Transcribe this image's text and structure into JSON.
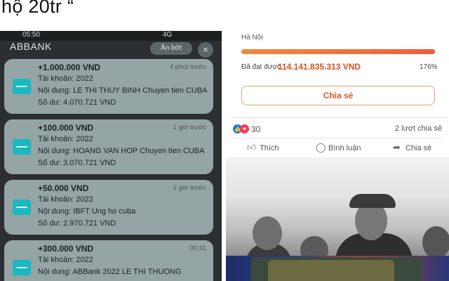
{
  "caption": {
    "text": "hộ 20tr “"
  },
  "phone": {
    "status_time": "05:50",
    "status_signal": "4G",
    "app_name": "ABBANK",
    "hide_label": "Ẩn bớt",
    "close_label": "×",
    "notifications": [
      {
        "amount": "+1.000.000 VND",
        "time": "4 phút trước",
        "account": "Tài khoản: 2022",
        "content": "Nội dung: LE THI THUY BINH Chuyen tien CUBA",
        "balance": "Số dư: 4.070.721 VND"
      },
      {
        "amount": "+100.000 VND",
        "time": "1 giờ trước",
        "account": "Tài khoản: 2022",
        "content": "Nội dung: HOANG VAN HOP Chuyen tien CUBA",
        "balance": "Số dư: 3.070.721 VND"
      },
      {
        "amount": "+50.000 VND",
        "time": "2 giờ trước",
        "account": "Tài khoản: 2022",
        "content": "Nội dung: IBFT Ung ho cuba",
        "balance": "Số dư: 2.970.721 VND"
      },
      {
        "amount": "+300.000 VND",
        "time": "00:31",
        "account": "Tài khoản: 2022",
        "content": "Nội dung: ABBank 2022 LE THI THUONG",
        "balance": ""
      }
    ]
  },
  "fundraiser": {
    "location": "Hà Nội",
    "raised_label": "Đã đạt được",
    "raised_value": "114.141.835.313 VND",
    "percent": "176%",
    "progress_fraction": 1.0,
    "share_button": "Chia sẻ"
  },
  "post": {
    "reaction_count": "30",
    "shares": "2 lượt chia sẻ",
    "actions": {
      "like": "Thích",
      "comment": "Bình luận",
      "share": "Chia sẻ"
    }
  },
  "colors": {
    "accent": "#d9541f",
    "notification_bg": "#95a4a5",
    "bank_logo": "#1ab8c0",
    "facebook_blue": "#1877f2"
  }
}
